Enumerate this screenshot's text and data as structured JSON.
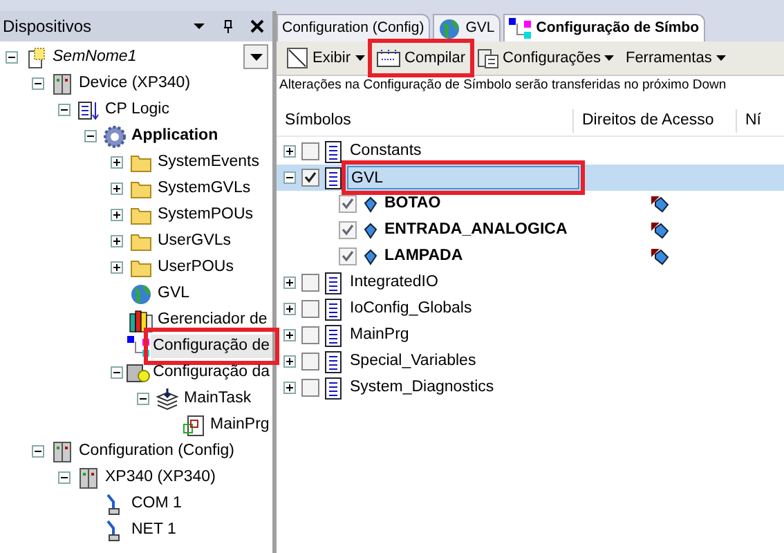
{
  "devices_panel": {
    "title": "Dispositivos",
    "tree": [
      {
        "label": "SemNome1",
        "kind": "project",
        "expanded": true,
        "selected": false,
        "highlighted": false,
        "children": [
          {
            "label": "Device (XP340)",
            "kind": "device",
            "expanded": true,
            "selected": false,
            "highlighted": false,
            "children": [
              {
                "label": "CP Logic",
                "kind": "logic",
                "expanded": true,
                "selected": false,
                "highlighted": false,
                "children": [
                  {
                    "label": "Application",
                    "kind": "application",
                    "expanded": true,
                    "selected": false,
                    "highlighted": false,
                    "children": [
                      {
                        "label": "SystemEvents",
                        "kind": "folder",
                        "expanded": false,
                        "selected": false,
                        "highlighted": false
                      },
                      {
                        "label": "SystemGVLs",
                        "kind": "folder",
                        "expanded": false,
                        "selected": false,
                        "highlighted": false
                      },
                      {
                        "label": "SystemPOUs",
                        "kind": "folder",
                        "expanded": false,
                        "selected": false,
                        "highlighted": false
                      },
                      {
                        "label": "UserGVLs",
                        "kind": "folder",
                        "expanded": false,
                        "selected": false,
                        "highlighted": false
                      },
                      {
                        "label": "UserPOUs",
                        "kind": "folder",
                        "expanded": false,
                        "selected": false,
                        "highlighted": false
                      },
                      {
                        "label": "GVL",
                        "kind": "globe",
                        "selected": false,
                        "highlighted": false
                      },
                      {
                        "label": "Gerenciador de",
                        "kind": "library",
                        "selected": false,
                        "highlighted": false
                      },
                      {
                        "label": "Configuração de",
                        "kind": "symbols",
                        "selected": true,
                        "highlighted": true
                      },
                      {
                        "label": "Configuração da",
                        "kind": "task-config",
                        "expanded": true,
                        "selected": false,
                        "highlighted": false,
                        "children": [
                          {
                            "label": "MainTask",
                            "kind": "task",
                            "expanded": true,
                            "selected": false,
                            "highlighted": false,
                            "children": [
                              {
                                "label": "MainPrg",
                                "kind": "program",
                                "selected": false,
                                "highlighted": false
                              }
                            ]
                          }
                        ]
                      }
                    ]
                  }
                ]
              }
            ]
          },
          {
            "label": "Configuration (Config)",
            "kind": "device",
            "expanded": true,
            "selected": false,
            "highlighted": false,
            "children": [
              {
                "label": "XP340 (XP340)",
                "kind": "device",
                "expanded": true,
                "selected": false,
                "highlighted": false,
                "children": [
                  {
                    "label": "COM 1",
                    "kind": "port",
                    "selected": false,
                    "highlighted": false
                  },
                  {
                    "label": "NET 1",
                    "kind": "port",
                    "selected": false,
                    "highlighted": false
                  }
                ]
              }
            ]
          }
        ]
      }
    ]
  },
  "tabs": [
    {
      "label": "Configuration (Config)",
      "kind": "device",
      "selected": false
    },
    {
      "label": "GVL",
      "kind": "globe",
      "selected": false
    },
    {
      "label": "Configuração de Símbo",
      "kind": "symbols",
      "selected": true
    }
  ],
  "toolbar": [
    {
      "label": "Exibir",
      "kind": "view",
      "dropdown": true,
      "highlighted": false
    },
    {
      "label": "Compilar",
      "kind": "build",
      "dropdown": false,
      "highlighted": true
    },
    {
      "label": "Configurações",
      "kind": "settings",
      "dropdown": true,
      "highlighted": false
    },
    {
      "label": "Ferramentas",
      "kind": "none",
      "dropdown": true,
      "highlighted": false
    }
  ],
  "info": "Alterações na Configuração de Símbolo serão transferidas no próximo Down",
  "table": {
    "columns": [
      "Símbolos",
      "Direitos de Acesso",
      "Ní"
    ],
    "rows": [
      {
        "label": "Constants",
        "kind": "list",
        "checked": false,
        "expanded": false,
        "selected": false,
        "highlighted": false
      },
      {
        "label": "GVL",
        "kind": "list",
        "checked": true,
        "expanded": true,
        "selected": true,
        "highlighted": true,
        "children": [
          {
            "label": "BOTAO",
            "kind": "variable",
            "checked": true,
            "access": true
          },
          {
            "label": "ENTRADA_ANALOGICA",
            "kind": "variable",
            "checked": true,
            "access": true
          },
          {
            "label": "LAMPADA",
            "kind": "variable",
            "checked": true,
            "access": true
          }
        ]
      },
      {
        "label": "IntegratedIO",
        "kind": "list",
        "checked": false,
        "expanded": false,
        "selected": false,
        "highlighted": false
      },
      {
        "label": "IoConfig_Globals",
        "kind": "list",
        "checked": false,
        "expanded": false,
        "selected": false,
        "highlighted": false
      },
      {
        "label": "MainPrg",
        "kind": "list",
        "checked": false,
        "expanded": false,
        "selected": false,
        "highlighted": false
      },
      {
        "label": "Special_Variables",
        "kind": "list",
        "checked": false,
        "expanded": false,
        "selected": false,
        "highlighted": false
      },
      {
        "label": "System_Diagnostics",
        "kind": "list",
        "checked": false,
        "expanded": false,
        "selected": false,
        "highlighted": false
      }
    ]
  }
}
